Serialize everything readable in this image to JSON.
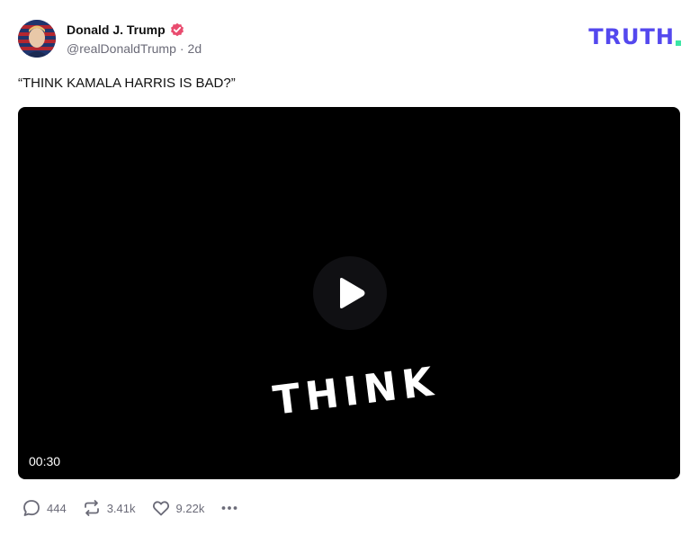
{
  "post": {
    "author_name": "Donald J. Trump",
    "handle": "@realDonaldTrump",
    "separator": "·",
    "time_ago": "2d",
    "text": "“THINK KAMALA HARRIS IS BAD?”"
  },
  "brand": {
    "logo_text": "TRUTH",
    "primary_color": "#5448ee",
    "accent_color": "#3ce6a5",
    "verified_color": "#e94c6f"
  },
  "video": {
    "overlay_text": "THINK",
    "duration": "00:30"
  },
  "actions": {
    "replies": "444",
    "retruths": "3.41k",
    "likes": "9.22k"
  }
}
